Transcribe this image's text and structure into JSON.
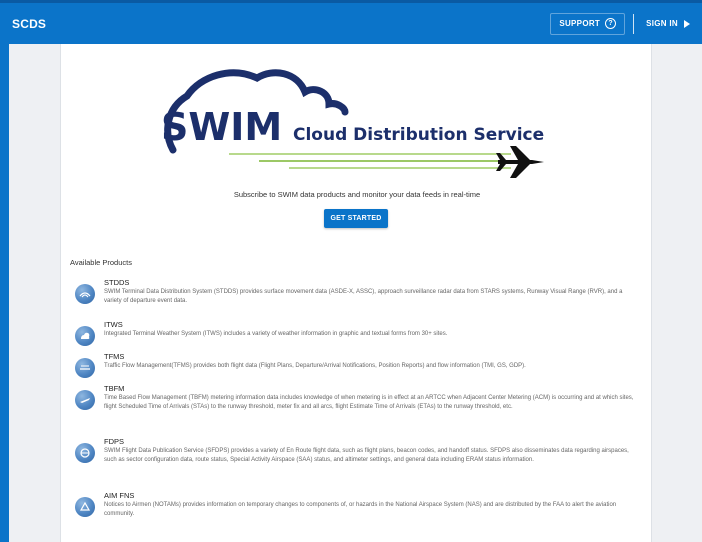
{
  "header": {
    "brand": "SCDS",
    "support_label": "SUPPORT",
    "signin_label": "SIGN IN",
    "bar_color": "#0b74c9"
  },
  "hero": {
    "logo_word": "SWIM",
    "logo_subtitle": "Cloud Distribution Service",
    "tagline": "Subscribe to SWIM data products and monitor your data feeds in real-time",
    "cta_label": "GET STARTED"
  },
  "products": {
    "heading": "Available Products",
    "items": [
      {
        "name": "STDDS",
        "icon": "radar-icon",
        "description": "SWIM Terminal Data Distribution System (STDDS) provides surface movement data (ASDE-X, ASSC), approach surveillance radar data from STARS systems, Runway Visual Range (RVR), and a variety of departure event data."
      },
      {
        "name": "ITWS",
        "icon": "weather-icon",
        "description": "Integrated Terminal Weather System (ITWS) includes a variety of weather information in graphic and textual forms from 30+ sites."
      },
      {
        "name": "TFMS",
        "icon": "traffic-flow-icon",
        "description": "Traffic Flow Management(TFMS) provides both flight data (Flight Plans, Departure/Arrival Notifications, Position Reports) and flow information (TMI, GS, GDP)."
      },
      {
        "name": "TBFM",
        "icon": "airplane-icon",
        "description": "Time Based Flow Management (TBFM) metering information data includes knowledge of when metering is in effect at an ARTCC when Adjacent Center Metering (ACM) is occurring and at which sites, flight Scheduled Time of Arrivals (STAs) to the runway threshold, meter fix and all arcs, flight Estimate Time of Arrivals (ETAs) to the runway threshold, etc."
      },
      {
        "name": "FDPS",
        "icon": "flight-data-icon",
        "description": "SWIM Flight Data Publication Service (SFDPS) provides a variety of En Route flight data, such as flight plans, beacon codes, and handoff status. SFDPS also disseminates data regarding airspaces, such as sector configuration data, route status, Special Activity Airspace (SAA) status, and altimeter settings, and general data including ERAM status information."
      },
      {
        "name": "AIM FNS",
        "icon": "notam-icon",
        "description": "Notices to Airmen (NOTAMs) provides information on temporary changes to components of, or hazards in the National Airspace System (NAS) and are distributed by the FAA to alert the aviation community."
      }
    ]
  }
}
